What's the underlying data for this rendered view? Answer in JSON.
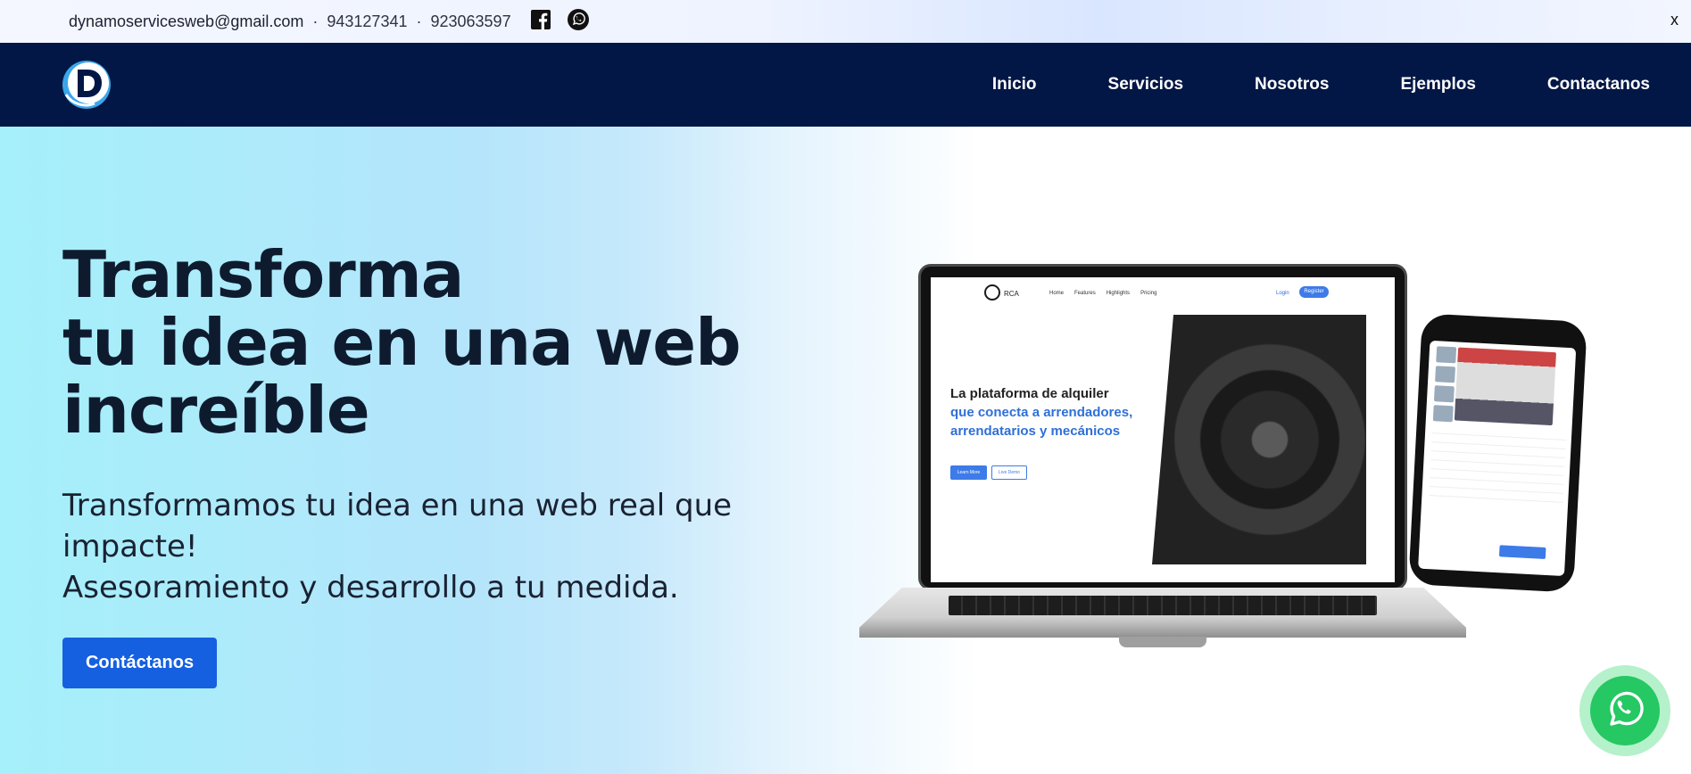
{
  "topbar": {
    "email": "dynamoservicesweb@gmail.com",
    "phone_1": "943127341",
    "phone_2": "923063597",
    "separator": "·",
    "close_label": "x"
  },
  "nav": {
    "items": [
      {
        "label": "Inicio"
      },
      {
        "label": "Servicios"
      },
      {
        "label": "Nosotros"
      },
      {
        "label": "Ejemplos"
      },
      {
        "label": "Contactanos"
      }
    ]
  },
  "hero": {
    "title_line1": "Transforma",
    "title_line2": "tu idea en una web",
    "title_line3": "increíble",
    "subtitle_line1": "Transformamos tu idea en una web real que impacte!",
    "subtitle_line2": "Asesoramiento y desarrollo a tu medida.",
    "cta_label": "Contáctanos"
  },
  "mockup": {
    "brand": "RCA",
    "links": [
      "Home",
      "Features",
      "Highlights",
      "Pricing"
    ],
    "login": "Login",
    "register": "Register",
    "headline_1": "La plataforma de alquiler",
    "headline_2": "que conecta a arrendadores, arrendatarios y mecánicos",
    "btn_primary": "Learn More",
    "btn_secondary": "Live Demo"
  },
  "colors": {
    "nav_bg": "#021745",
    "accent": "#1560e0",
    "whatsapp": "#25c862"
  }
}
